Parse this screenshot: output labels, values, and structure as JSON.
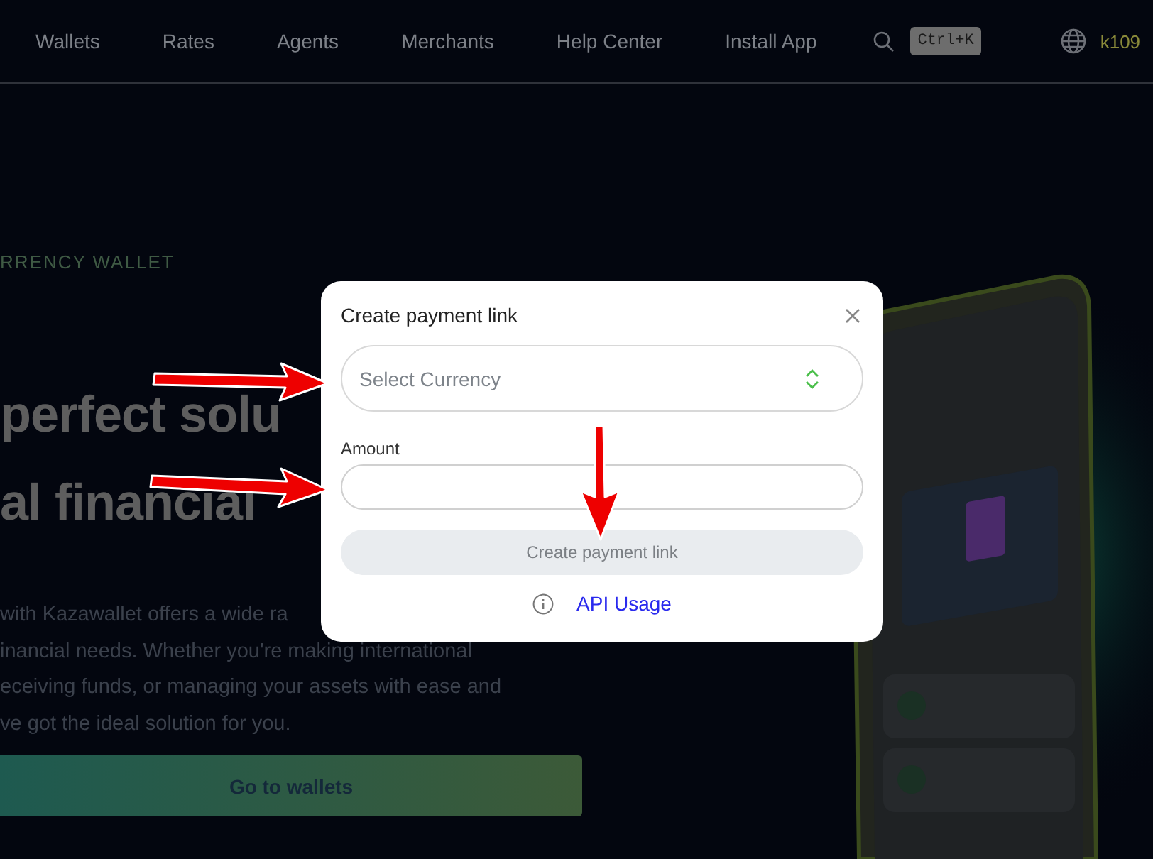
{
  "nav": {
    "items": [
      "Wallets",
      "Rates",
      "Agents",
      "Merchants",
      "Help Center",
      "Install App"
    ],
    "shortcut": "Ctrl+K",
    "account": "k109"
  },
  "hero": {
    "eyebrow": "RRENCY WALLET",
    "heading_lines": [
      "perfect solu",
      "al financial"
    ],
    "paragraph_lines": [
      "with Kazawallet offers a wide ra",
      "inancial needs. Whether you're making international",
      "eceiving funds, or managing your assets with ease and",
      "ve got the ideal solution for you."
    ],
    "button": "Go to wallets"
  },
  "dialog": {
    "title": "Create payment link",
    "currency_select": {
      "placeholder": "Select Currency"
    },
    "amount": {
      "label": "Amount"
    },
    "submit": {
      "label": "Create payment link",
      "disabled": true
    },
    "link": "API Usage"
  }
}
